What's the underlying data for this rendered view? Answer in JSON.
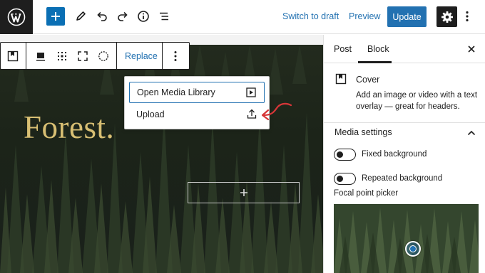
{
  "topbar": {
    "switch_to_draft": "Switch to draft",
    "preview": "Preview",
    "update": "Update"
  },
  "toolbar": {
    "replace": "Replace"
  },
  "cover": {
    "title": "Forest."
  },
  "media_menu": {
    "items": [
      {
        "label": "Open Media Library",
        "icon": "media-play-icon"
      },
      {
        "label": "Upload",
        "icon": "upload-icon"
      }
    ]
  },
  "sidebar": {
    "tabs": [
      "Post",
      "Block"
    ],
    "active_tab": "Block",
    "block": {
      "title": "Cover",
      "description": "Add an image or video with a text overlay — great for headers."
    },
    "media_settings": {
      "title": "Media settings",
      "fixed_background": {
        "label": "Fixed background",
        "on": false
      },
      "repeated_background": {
        "label": "Repeated background",
        "on": false
      },
      "focal_point_label": "Focal point picker"
    }
  },
  "colors": {
    "accent": "#2271b1",
    "plus_button": "#0a6fb4",
    "dark": "#1e1e1e",
    "cover_title": "#d8bf73",
    "annotation_arrow": "#d63638"
  }
}
